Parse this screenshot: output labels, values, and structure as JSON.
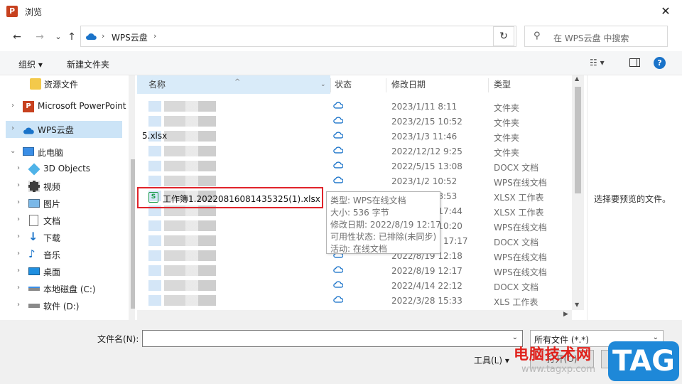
{
  "window": {
    "title": "浏览",
    "app_icon": "P"
  },
  "nav": {
    "back": "←",
    "forward": "→",
    "recent": "⌄",
    "up": "↑",
    "breadcrumb": "WPS云盘",
    "refresh": "↻",
    "search_placeholder": "在 WPS云盘 中搜索"
  },
  "toolbar": {
    "organize": "组织 ▾",
    "new_folder": "新建文件夹",
    "view": "☷ ▾",
    "help": "?"
  },
  "sidebar": {
    "items": [
      {
        "label": "资源文件",
        "icon": "folder-icon"
      },
      {
        "label": "Microsoft PowerPoint",
        "icon": "powerpoint-icon"
      },
      {
        "label": "WPS云盘",
        "icon": "cloud-icon",
        "selected": true
      },
      {
        "label": "此电脑",
        "icon": "computer-icon"
      },
      {
        "label": "3D Objects",
        "icon": "3d-objects-icon"
      },
      {
        "label": "视频",
        "icon": "video-icon"
      },
      {
        "label": "图片",
        "icon": "picture-icon"
      },
      {
        "label": "文档",
        "icon": "document-icon"
      },
      {
        "label": "下载",
        "icon": "download-icon"
      },
      {
        "label": "音乐",
        "icon": "music-icon"
      },
      {
        "label": "桌面",
        "icon": "desktop-icon"
      },
      {
        "label": "本地磁盘 (C:)",
        "icon": "drive-icon"
      },
      {
        "label": "软件 (D:)",
        "icon": "drive-icon"
      }
    ]
  },
  "columns": {
    "name": "名称",
    "status": "状态",
    "modified": "修改日期",
    "type": "类型"
  },
  "files": [
    {
      "date": "2023/1/11 8:11",
      "type": "文件夹"
    },
    {
      "date": "2023/2/15 10:52",
      "type": "文件夹"
    },
    {
      "date": "2023/1/3 11:46",
      "type": "文件夹"
    },
    {
      "date": "2022/12/12 9:25",
      "type": "文件夹"
    },
    {
      "date": "2022/5/15 13:08",
      "type": "DOCX 文档"
    },
    {
      "date": "2023/1/2 10:52",
      "type": "WPS在线文档"
    },
    {
      "date": "2023/4/27 8:53",
      "type": "XLSX 工作表"
    },
    {
      "date": "2022/8/16 17:44",
      "type": "XLSX 工作表"
    },
    {
      "date": "2022/8/19 10:20",
      "type": "WPS在线文档"
    },
    {
      "date": "2020/10/17 17:17",
      "type": "DOCX 文档"
    },
    {
      "date": "2022/8/19 12:18",
      "type": "WPS在线文档"
    },
    {
      "date": "2022/8/19 12:17",
      "type": "WPS在线文档"
    },
    {
      "date": "2022/4/14 22:12",
      "type": "DOCX 文档"
    },
    {
      "date": "2022/3/28 15:33",
      "type": "XLS 工作表"
    }
  ],
  "highlighted_file": {
    "name": "工作簿1.20220816081435325(1).xlsx",
    "icon": "S"
  },
  "under_name": "5.xlsx",
  "tooltip": [
    "类型: WPS在线文档",
    "大小: 536 字节",
    "修改日期: 2022/8/19 12:17",
    "可用性状态: 已排除(未同步)",
    "活动: 在线文档"
  ],
  "preview_message": "选择要预览的文件。",
  "bottom": {
    "filename_label": "文件名(N):",
    "filename_value": "",
    "filter": "所有文件 (*.*)",
    "tools": "工具(L) ▾",
    "open": "打开(O)",
    "cancel": "取消"
  },
  "watermark": {
    "text": "电脑技术网",
    "url": "www.tagxp.com",
    "tag": "TAG"
  },
  "colors": {
    "accent": "#1a73c9",
    "highlight_border": "#e0242b",
    "selected_bg": "#cce4f7",
    "excel_green": "#1b9c4a"
  }
}
